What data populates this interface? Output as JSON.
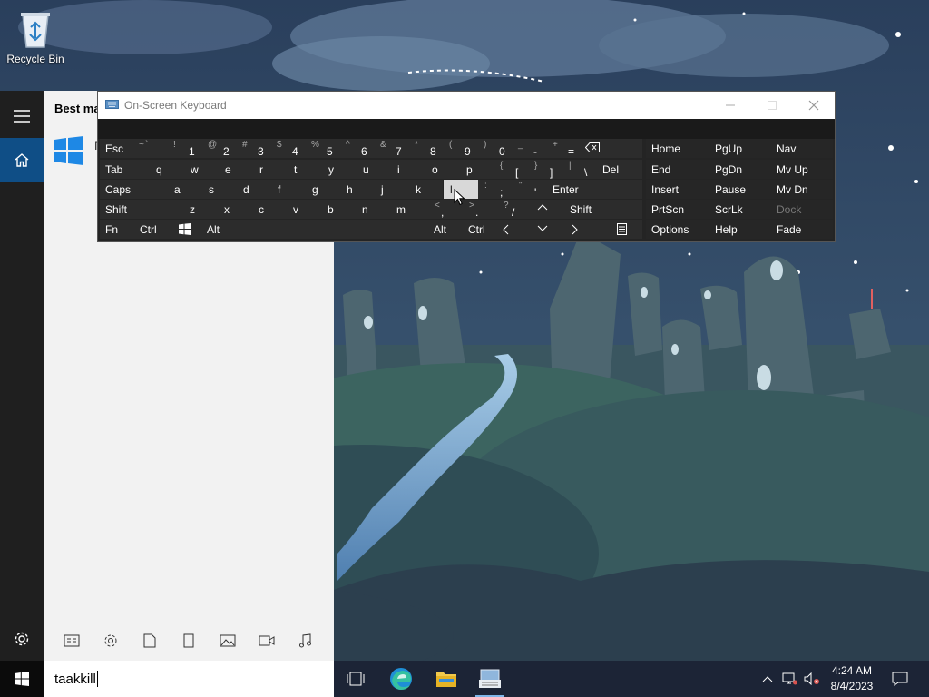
{
  "desktop": {
    "recycle_bin_label": "Recycle Bin"
  },
  "start_menu": {
    "best_match_label": "Best match",
    "result_name_visible": "N",
    "filters": [
      "apps-filter-icon",
      "settings-filter-icon",
      "documents-filter-icon",
      "tablet-filter-icon",
      "photos-filter-icon",
      "videos-filter-icon",
      "music-filter-icon"
    ]
  },
  "taskbar": {
    "search_text": "taakkill",
    "clock_time": "4:24 AM",
    "clock_date": "8/4/2023",
    "pinned": [
      "task-view-icon",
      "edge-icon",
      "file-explorer-icon",
      "on-screen-keyboard-icon"
    ]
  },
  "osk": {
    "title": "On-Screen Keyboard",
    "keys": {
      "esc": "Esc",
      "tilde_s": "~",
      "tilde_m": "`",
      "n1_s": "!",
      "n1": "1",
      "n2_s": "@",
      "n2": "2",
      "n3_s": "#",
      "n3": "3",
      "n4_s": "$",
      "n4": "4",
      "n5_s": "%",
      "n5": "5",
      "n6_s": "^",
      "n6": "6",
      "n7_s": "&",
      "n7": "7",
      "n8_s": "*",
      "n8": "8",
      "n9_s": "(",
      "n9": "9",
      "n0_s": ")",
      "n0": "0",
      "minus_s": "_",
      "minus": "-",
      "eq_s": "+",
      "eq": "=",
      "tab": "Tab",
      "q": "q",
      "w": "w",
      "e": "e",
      "r": "r",
      "t": "t",
      "y": "y",
      "u": "u",
      "i": "i",
      "o": "o",
      "p": "p",
      "lbr_s": "{",
      "lbr": "[",
      "rbr_s": "}",
      "rbr": "]",
      "bsl_s": "|",
      "bsl": "\\",
      "del": "Del",
      "caps": "Caps",
      "a": "a",
      "s": "s",
      "d": "d",
      "f": "f",
      "g": "g",
      "h": "h",
      "j": "j",
      "k": "k",
      "l": "l",
      "semi_s": ":",
      "semi": ";",
      "quot_s": "\"",
      "quot": "'",
      "enter": "Enter",
      "shift": "Shift",
      "z": "z",
      "x": "x",
      "c": "c",
      "v": "v",
      "b": "b",
      "n": "n",
      "m": "m",
      "comma_s": "<",
      "comma": ",",
      "dot_s": ">",
      "dot": ".",
      "slash_s": "?",
      "slash": "/",
      "shift_r": "Shift",
      "fn": "Fn",
      "ctrl": "Ctrl",
      "alt": "Alt",
      "alt_r": "Alt",
      "ctrl_r": "Ctrl",
      "home": "Home",
      "pgup": "PgUp",
      "nav": "Nav",
      "end": "End",
      "pgdn": "PgDn",
      "mvup": "Mv Up",
      "insert": "Insert",
      "pause": "Pause",
      "mvdn": "Mv Dn",
      "prtscn": "PrtScn",
      "scrlk": "ScrLk",
      "dock": "Dock",
      "options": "Options",
      "help": "Help",
      "fade": "Fade"
    }
  }
}
